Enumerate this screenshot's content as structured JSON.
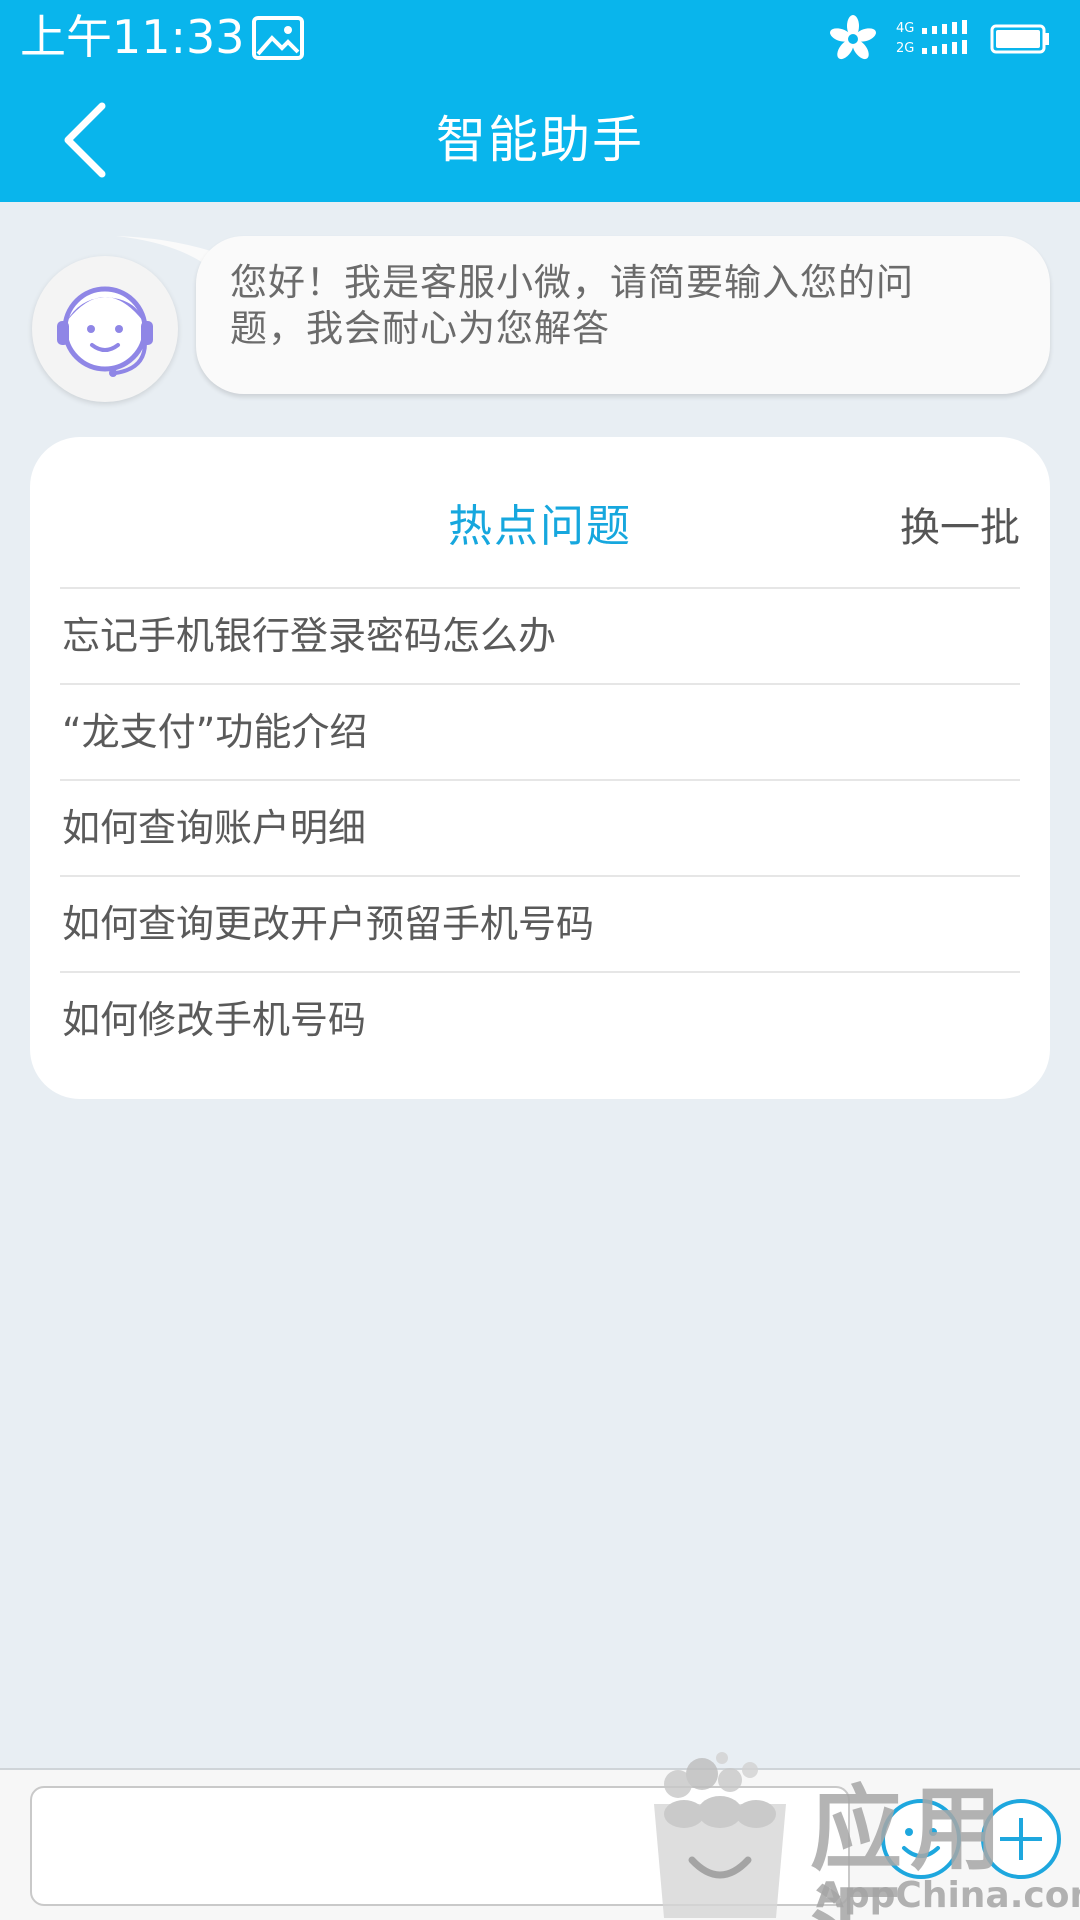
{
  "status_bar": {
    "time": "上午11:33",
    "network_top": "4G",
    "network_bottom": "2G"
  },
  "header": {
    "title": "智能助手"
  },
  "welcome": {
    "line1": "您好！我是客服小微，请简要输入您的问",
    "line2": "题，我会耐心为您解答"
  },
  "hot_questions": {
    "title": "热点问题",
    "refresh_label": "换一批",
    "items": [
      "忘记手机银行登录密码怎么办",
      "“龙支付”功能介绍",
      "如何查询账户明细",
      "如何查询更改开户预留手机号码",
      "如何修改手机号码"
    ]
  },
  "input_bar": {
    "value": "",
    "placeholder": ""
  },
  "watermark": {
    "brand": "应用汇",
    "domain": "AppChina.com"
  },
  "colors": {
    "header_bg": "#09b5ec",
    "page_bg": "#e8eef3",
    "accent_title": "#16a7de",
    "watermark": "#a7a7a7"
  },
  "icons": {
    "status": [
      "gallery-icon",
      "flower-icon",
      "signal-icon",
      "battery-icon"
    ],
    "header": [
      "back-arrow-icon"
    ],
    "avatar": "customer-service-agent-icon",
    "input_bar": [
      "emoji-icon",
      "add-icon"
    ]
  }
}
